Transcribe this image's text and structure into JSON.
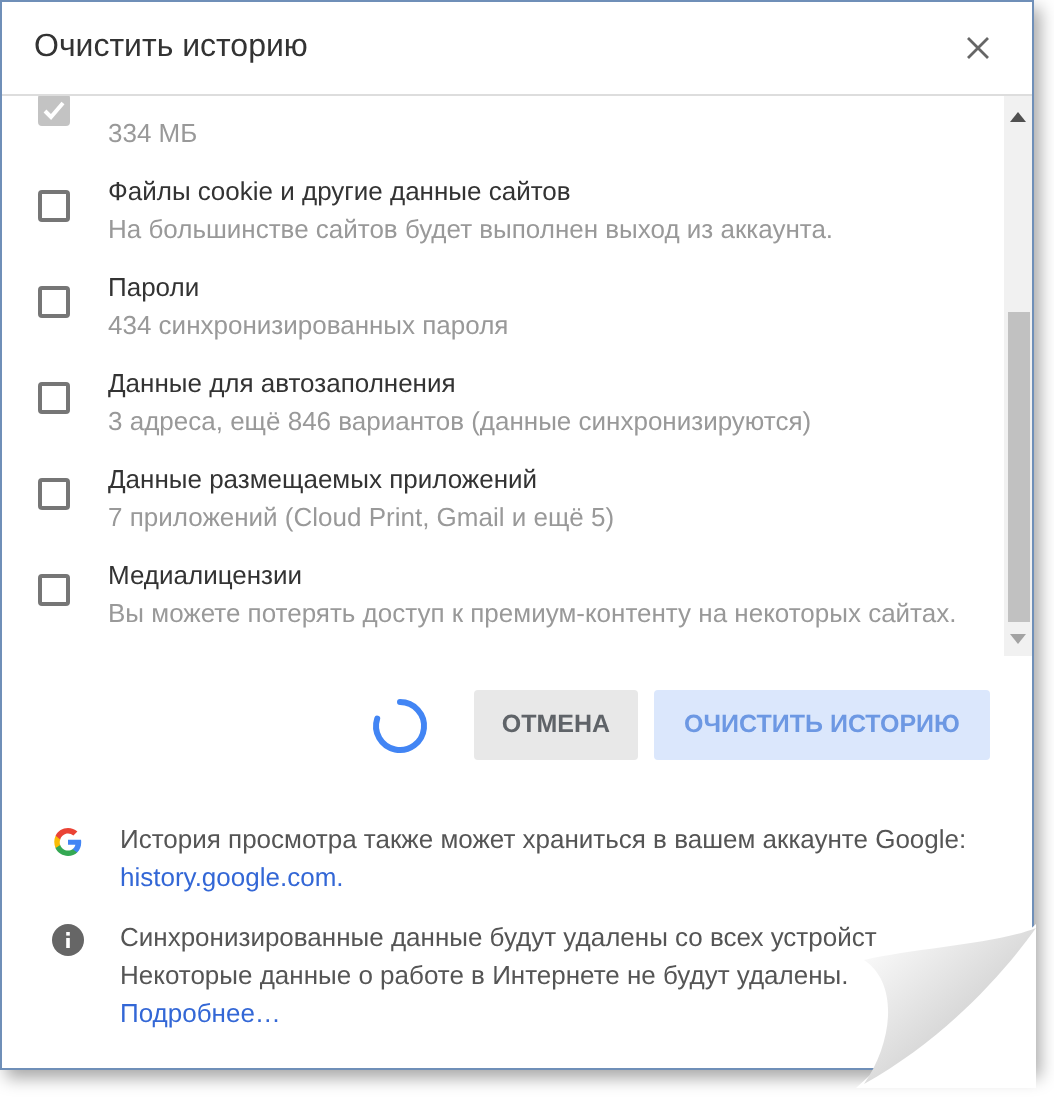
{
  "dialog": {
    "title": "Очистить историю"
  },
  "items": [
    {
      "subtitle": "334 МБ",
      "checked": true,
      "disabled": true
    },
    {
      "label": "Файлы cookie и другие данные сайтов",
      "subtitle": "На большинстве сайтов будет выполнен выход из аккаунта.",
      "checked": false,
      "disabled": false
    },
    {
      "label": "Пароли",
      "subtitle": "434 синхронизированных пароля",
      "checked": false,
      "disabled": false
    },
    {
      "label": "Данные для автозаполнения",
      "subtitle": "3 адреса, ещё 846 вариантов (данные синхронизируются)",
      "checked": false,
      "disabled": false
    },
    {
      "label": "Данные размещаемых приложений",
      "subtitle": "7 приложений (Cloud Print, Gmail и ещё 5)",
      "checked": false,
      "disabled": false
    },
    {
      "label": "Медиалицензии",
      "subtitle": "Вы можете потерять доступ к премиум-контенту на некоторых сайтах.",
      "checked": false,
      "disabled": false
    }
  ],
  "buttons": [
    {
      "label": "ОТМЕНА",
      "kind": "secondary",
      "disabled": false
    },
    {
      "label": "ОЧИСТИТЬ ИСТОРИЮ",
      "kind": "primary",
      "disabled": true
    }
  ],
  "notes": [
    {
      "kind": "google",
      "lines": [
        "История просмотра также может храниться в вашем аккаунте Google:"
      ],
      "link": "history.google.com."
    },
    {
      "kind": "info",
      "lines": [
        "Синхронизированные данные будут удалены со всех устройст",
        "Некоторые данные о работе в Интернете не будут удалены."
      ],
      "link": "Подробнее…"
    }
  ]
}
